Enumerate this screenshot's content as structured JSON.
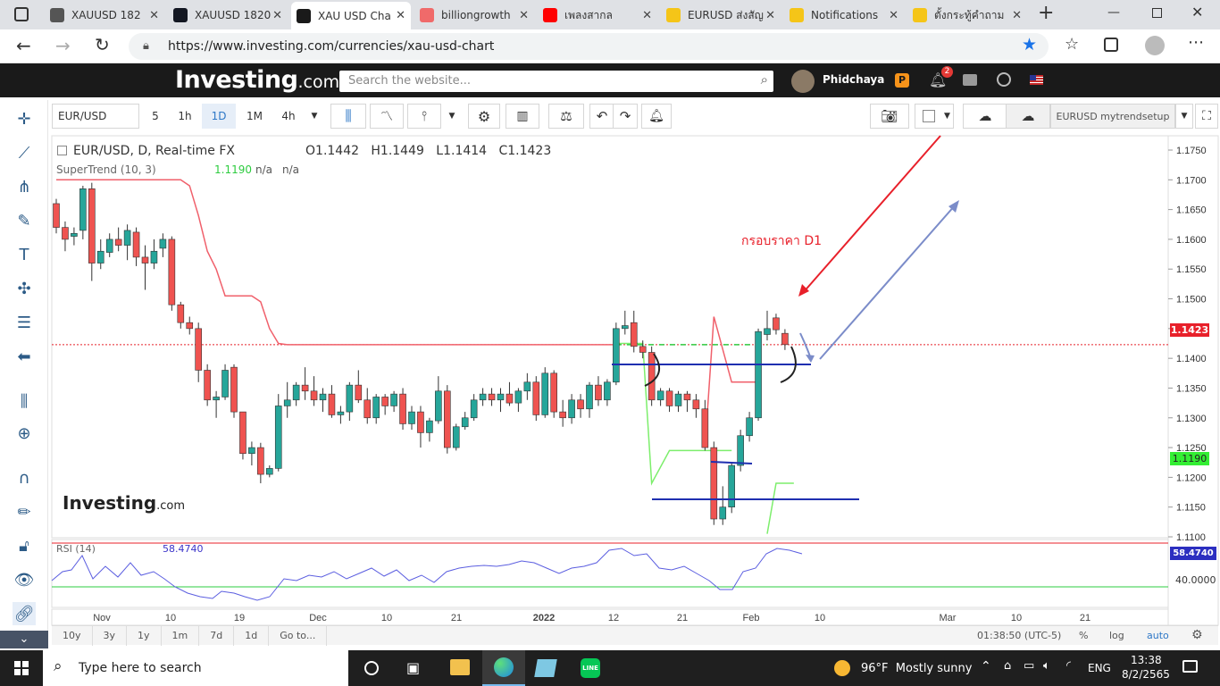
{
  "browser": {
    "tabs": [
      {
        "title": "XAUUSD 182",
        "icon": "tradingview-icon",
        "color": "#555555"
      },
      {
        "title": "XAUUSD 1820",
        "icon": "tradingview-icon",
        "color": "#131722"
      },
      {
        "title": "XAU USD Cha",
        "icon": "investing-icon",
        "color": "#1a1a1a",
        "active": true
      },
      {
        "title": "billiongrowth",
        "icon": "youtube-icon",
        "color": "#f06a6a"
      },
      {
        "title": "เพลงสากล",
        "icon": "youtube-icon",
        "color": "#ff0000"
      },
      {
        "title": "EURUSD ส่งสัญ",
        "icon": "emoji-icon",
        "color": "#f5c518"
      },
      {
        "title": "Notifications",
        "icon": "emoji-icon",
        "color": "#f5c518"
      },
      {
        "title": "ตั้งกระทู้คำถาม",
        "icon": "emoji-icon",
        "color": "#f5c518"
      }
    ],
    "url": "https://www.investing.com/currencies/xau-usd-chart"
  },
  "site": {
    "logo_main": "Investing",
    "logo_suffix": ".com",
    "search_placeholder": "Search the website...",
    "username": "Phidchaya",
    "notifications_count": "2"
  },
  "toolbar": {
    "symbol": "EUR/USD",
    "intervals": [
      "5",
      "1h",
      "1D",
      "1M",
      "4h"
    ],
    "active_interval": "1D",
    "layout_name": "EURUSD mytrendsetup"
  },
  "chart": {
    "title": "EUR/USD, D, Real-time FX",
    "ohlc": {
      "o_label": "O",
      "o": "1.1442",
      "h_label": "H",
      "h": "1.1449",
      "l_label": "L",
      "l": "1.1414",
      "c_label": "C",
      "c": "1.1423"
    },
    "supertrend_label": "SuperTrend (10, 3)",
    "supertrend_value": "1.1190",
    "na1": "n/a",
    "na2": "n/a",
    "annotation": "กรอบราคา D1",
    "watermark_main": "Investing",
    "watermark_suffix": ".com",
    "rsi_label": "RSI (14)",
    "rsi_value": "58.4740",
    "rsi_axis_value": "58.4740",
    "rsi_level": "40.0000",
    "price_last": "1.1423",
    "supertrend_axis": "1.1190",
    "footer_time": "01:38:50 (UTC-5)",
    "footer_percent": "%",
    "footer_log": "log",
    "footer_auto": "auto",
    "ranges": [
      "10y",
      "3y",
      "1y",
      "1m",
      "7d",
      "1d",
      "Go to..."
    ]
  },
  "chart_data": {
    "type": "candlestick",
    "price_axis_ticks": [
      "1.1750",
      "1.1700",
      "1.1650",
      "1.1600",
      "1.1550",
      "1.1500",
      "1.1450",
      "1.1400",
      "1.1350",
      "1.1300",
      "1.1250",
      "1.1200",
      "1.1150",
      "1.1100"
    ],
    "time_axis_ticks": [
      "Nov",
      "10",
      "19",
      "Dec",
      "10",
      "21",
      "2022",
      "12",
      "21",
      "Feb",
      "10",
      "Mar",
      "10",
      "21"
    ],
    "candles": [
      {
        "o": 1.166,
        "h": 1.1668,
        "l": 1.161,
        "c": 1.162
      },
      {
        "o": 1.162,
        "h": 1.163,
        "l": 1.158,
        "c": 1.16
      },
      {
        "o": 1.1605,
        "h": 1.162,
        "l": 1.159,
        "c": 1.161
      },
      {
        "o": 1.1615,
        "h": 1.169,
        "l": 1.16,
        "c": 1.1685
      },
      {
        "o": 1.1685,
        "h": 1.1695,
        "l": 1.153,
        "c": 1.156
      },
      {
        "o": 1.156,
        "h": 1.16,
        "l": 1.155,
        "c": 1.158
      },
      {
        "o": 1.1578,
        "h": 1.161,
        "l": 1.157,
        "c": 1.16
      },
      {
        "o": 1.16,
        "h": 1.162,
        "l": 1.158,
        "c": 1.159
      },
      {
        "o": 1.159,
        "h": 1.1625,
        "l": 1.1565,
        "c": 1.1615
      },
      {
        "o": 1.1612,
        "h": 1.162,
        "l": 1.1555,
        "c": 1.157
      },
      {
        "o": 1.157,
        "h": 1.159,
        "l": 1.1515,
        "c": 1.156
      },
      {
        "o": 1.156,
        "h": 1.16,
        "l": 1.155,
        "c": 1.158
      },
      {
        "o": 1.1585,
        "h": 1.161,
        "l": 1.157,
        "c": 1.16
      },
      {
        "o": 1.16,
        "h": 1.1605,
        "l": 1.148,
        "c": 1.149
      },
      {
        "o": 1.149,
        "h": 1.1495,
        "l": 1.145,
        "c": 1.146
      },
      {
        "o": 1.146,
        "h": 1.147,
        "l": 1.144,
        "c": 1.145
      },
      {
        "o": 1.145,
        "h": 1.146,
        "l": 1.136,
        "c": 1.138
      },
      {
        "o": 1.138,
        "h": 1.139,
        "l": 1.132,
        "c": 1.133
      },
      {
        "o": 1.133,
        "h": 1.1345,
        "l": 1.13,
        "c": 1.1335
      },
      {
        "o": 1.1335,
        "h": 1.139,
        "l": 1.133,
        "c": 1.138
      },
      {
        "o": 1.1385,
        "h": 1.139,
        "l": 1.13,
        "c": 1.131
      },
      {
        "o": 1.131,
        "h": 1.131,
        "l": 1.123,
        "c": 1.124
      },
      {
        "o": 1.124,
        "h": 1.126,
        "l": 1.122,
        "c": 1.125
      },
      {
        "o": 1.125,
        "h": 1.1258,
        "l": 1.119,
        "c": 1.1205
      },
      {
        "o": 1.1205,
        "h": 1.122,
        "l": 1.12,
        "c": 1.1215
      },
      {
        "o": 1.1215,
        "h": 1.134,
        "l": 1.121,
        "c": 1.132
      },
      {
        "o": 1.132,
        "h": 1.136,
        "l": 1.13,
        "c": 1.133
      },
      {
        "o": 1.133,
        "h": 1.136,
        "l": 1.132,
        "c": 1.1355
      },
      {
        "o": 1.1355,
        "h": 1.1385,
        "l": 1.133,
        "c": 1.1345
      },
      {
        "o": 1.1345,
        "h": 1.137,
        "l": 1.132,
        "c": 1.133
      },
      {
        "o": 1.133,
        "h": 1.135,
        "l": 1.131,
        "c": 1.134
      },
      {
        "o": 1.134,
        "h": 1.1355,
        "l": 1.13,
        "c": 1.1305
      },
      {
        "o": 1.1305,
        "h": 1.132,
        "l": 1.129,
        "c": 1.131
      },
      {
        "o": 1.131,
        "h": 1.136,
        "l": 1.1295,
        "c": 1.1355
      },
      {
        "o": 1.1355,
        "h": 1.138,
        "l": 1.1325,
        "c": 1.133
      },
      {
        "o": 1.133,
        "h": 1.135,
        "l": 1.129,
        "c": 1.13
      },
      {
        "o": 1.13,
        "h": 1.134,
        "l": 1.129,
        "c": 1.1335
      },
      {
        "o": 1.1335,
        "h": 1.134,
        "l": 1.1305,
        "c": 1.132
      },
      {
        "o": 1.132,
        "h": 1.1345,
        "l": 1.131,
        "c": 1.134
      },
      {
        "o": 1.134,
        "h": 1.135,
        "l": 1.128,
        "c": 1.129
      },
      {
        "o": 1.129,
        "h": 1.132,
        "l": 1.128,
        "c": 1.131
      },
      {
        "o": 1.131,
        "h": 1.132,
        "l": 1.125,
        "c": 1.1275
      },
      {
        "o": 1.1275,
        "h": 1.13,
        "l": 1.126,
        "c": 1.1295
      },
      {
        "o": 1.1295,
        "h": 1.137,
        "l": 1.129,
        "c": 1.1345
      },
      {
        "o": 1.1345,
        "h": 1.1355,
        "l": 1.124,
        "c": 1.125
      },
      {
        "o": 1.125,
        "h": 1.129,
        "l": 1.1245,
        "c": 1.1285
      },
      {
        "o": 1.1285,
        "h": 1.131,
        "l": 1.128,
        "c": 1.13
      },
      {
        "o": 1.13,
        "h": 1.134,
        "l": 1.1295,
        "c": 1.133
      },
      {
        "o": 1.133,
        "h": 1.135,
        "l": 1.132,
        "c": 1.134
      },
      {
        "o": 1.134,
        "h": 1.135,
        "l": 1.132,
        "c": 1.133
      },
      {
        "o": 1.133,
        "h": 1.135,
        "l": 1.131,
        "c": 1.134
      },
      {
        "o": 1.134,
        "h": 1.136,
        "l": 1.132,
        "c": 1.1325
      },
      {
        "o": 1.1325,
        "h": 1.135,
        "l": 1.131,
        "c": 1.1345
      },
      {
        "o": 1.1345,
        "h": 1.1375,
        "l": 1.133,
        "c": 1.136
      },
      {
        "o": 1.136,
        "h": 1.137,
        "l": 1.1295,
        "c": 1.1305
      },
      {
        "o": 1.1305,
        "h": 1.1385,
        "l": 1.13,
        "c": 1.1375
      },
      {
        "o": 1.1375,
        "h": 1.138,
        "l": 1.13,
        "c": 1.131
      },
      {
        "o": 1.131,
        "h": 1.133,
        "l": 1.1285,
        "c": 1.13
      },
      {
        "o": 1.13,
        "h": 1.134,
        "l": 1.129,
        "c": 1.133
      },
      {
        "o": 1.133,
        "h": 1.134,
        "l": 1.13,
        "c": 1.1315
      },
      {
        "o": 1.1315,
        "h": 1.136,
        "l": 1.13,
        "c": 1.1355
      },
      {
        "o": 1.1355,
        "h": 1.137,
        "l": 1.132,
        "c": 1.133
      },
      {
        "o": 1.133,
        "h": 1.1365,
        "l": 1.132,
        "c": 1.136
      },
      {
        "o": 1.136,
        "h": 1.146,
        "l": 1.1355,
        "c": 1.145
      },
      {
        "o": 1.145,
        "h": 1.148,
        "l": 1.144,
        "c": 1.1455
      },
      {
        "o": 1.146,
        "h": 1.148,
        "l": 1.141,
        "c": 1.142
      },
      {
        "o": 1.142,
        "h": 1.143,
        "l": 1.14,
        "c": 1.141
      },
      {
        "o": 1.141,
        "h": 1.142,
        "l": 1.132,
        "c": 1.133
      },
      {
        "o": 1.133,
        "h": 1.135,
        "l": 1.132,
        "c": 1.1345
      },
      {
        "o": 1.1345,
        "h": 1.135,
        "l": 1.131,
        "c": 1.132
      },
      {
        "o": 1.132,
        "h": 1.1345,
        "l": 1.131,
        "c": 1.134
      },
      {
        "o": 1.134,
        "h": 1.1345,
        "l": 1.131,
        "c": 1.133
      },
      {
        "o": 1.133,
        "h": 1.134,
        "l": 1.13,
        "c": 1.1315
      },
      {
        "o": 1.1315,
        "h": 1.133,
        "l": 1.1245,
        "c": 1.125
      },
      {
        "o": 1.125,
        "h": 1.126,
        "l": 1.112,
        "c": 1.113
      },
      {
        "o": 1.113,
        "h": 1.1185,
        "l": 1.112,
        "c": 1.115
      },
      {
        "o": 1.115,
        "h": 1.1225,
        "l": 1.114,
        "c": 1.122
      },
      {
        "o": 1.122,
        "h": 1.128,
        "l": 1.121,
        "c": 1.127
      },
      {
        "o": 1.127,
        "h": 1.131,
        "l": 1.126,
        "c": 1.13
      },
      {
        "o": 1.13,
        "h": 1.145,
        "l": 1.1295,
        "c": 1.1445
      },
      {
        "o": 1.144,
        "h": 1.148,
        "l": 1.143,
        "c": 1.145
      },
      {
        "o": 1.1468,
        "h": 1.1475,
        "l": 1.144,
        "c": 1.1448
      },
      {
        "o": 1.1442,
        "h": 1.1449,
        "l": 1.1414,
        "c": 1.1423
      }
    ],
    "supertrend_bear": [
      1.17,
      1.17,
      1.17,
      1.17,
      1.17,
      1.17,
      1.17,
      1.17,
      1.17,
      1.17,
      1.17,
      1.17,
      1.17,
      1.17,
      1.17,
      1.169,
      1.164,
      1.158,
      1.155,
      1.1505,
      1.1505,
      1.1505,
      1.1505,
      1.1495,
      1.145,
      1.1425,
      1.1423,
      1.1423,
      1.1423,
      1.1423,
      1.1423,
      1.1423,
      1.1423,
      1.1423,
      1.1423,
      1.1423,
      1.1423,
      1.1423,
      1.1423,
      1.1423,
      1.1423,
      1.1423,
      1.1423,
      1.1423,
      1.1423,
      1.1423,
      1.1423,
      1.1423,
      1.1423,
      1.1423,
      1.1423,
      1.1423,
      1.1423,
      1.1423,
      1.1423,
      1.1423,
      1.1423,
      1.1423,
      1.1423,
      1.1423,
      1.1423,
      1.1423,
      1.1423,
      1.1423
    ],
    "rsi_levels": {
      "upper": 70,
      "lower": 40
    },
    "rsi_last": 58.474
  },
  "taskbar": {
    "search_placeholder": "Type here to search",
    "weather": "96°F  Mostly sunny",
    "language": "ENG",
    "time": "13:38",
    "date": "8/2/2565"
  },
  "colors": {
    "bull": "#26a69a",
    "bear": "#ef5350",
    "supertrend_up": "#7dee6c",
    "supertrend_down": "#f0606b",
    "accent": "#2e78c7"
  }
}
